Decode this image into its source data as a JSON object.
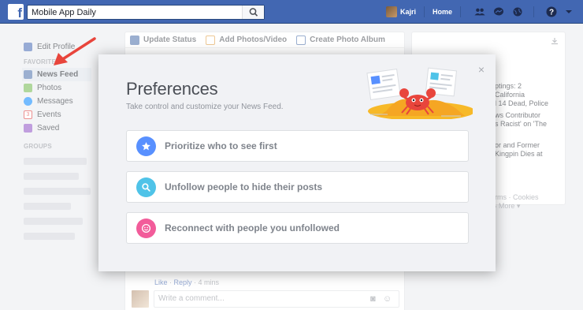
{
  "topbar": {
    "search_value": "Mobile App Daily",
    "user_name": "Kajri",
    "home_label": "Home",
    "brand_color": "#4267b2"
  },
  "left_nav": {
    "edit_profile": "Edit Profile",
    "favorites_heading": "FAVORITES",
    "items": [
      {
        "label": "News Feed",
        "icon": "news-feed-icon"
      },
      {
        "label": "Photos",
        "icon": "photos-icon"
      },
      {
        "label": "Messages",
        "icon": "messages-icon"
      },
      {
        "label": "Events",
        "icon": "events-icon"
      },
      {
        "label": "Saved",
        "icon": "saved-icon"
      }
    ],
    "events_badge": "3",
    "groups_heading": "GROUPS"
  },
  "composer": {
    "tabs": [
      {
        "label": "Update Status",
        "icon": "pencil-icon"
      },
      {
        "label": "Add Photos/Video",
        "icon": "photo-icon"
      },
      {
        "label": "Create Photo Album",
        "icon": "album-icon"
      }
    ]
  },
  "comment": {
    "like": "Like",
    "reply": "Reply",
    "time": "4 mins",
    "placeholder": "Write a comment..."
  },
  "right_panel": {
    "lines_1": [
      "ptings: 2",
      "California",
      "l 14 Dead, Police"
    ],
    "lines_2": [
      "ws Contributor",
      "s Racist' on 'The"
    ],
    "lines_3": [
      "or and Former",
      "Kingpin Dies at"
    ],
    "footer_1": "rms · Cookies",
    "footer_2": "More"
  },
  "modal": {
    "title": "Preferences",
    "subtitle": "Take control and customize your News Feed.",
    "close": "×",
    "options": [
      {
        "label": "Prioritize who to see first",
        "icon": "star-icon",
        "color": "#5890ff"
      },
      {
        "label": "Unfollow people to hide their posts",
        "icon": "search-icon",
        "color": "#4fc3e8"
      },
      {
        "label": "Reconnect with people you unfollowed",
        "icon": "smile-icon",
        "color": "#f25c9a"
      }
    ]
  }
}
